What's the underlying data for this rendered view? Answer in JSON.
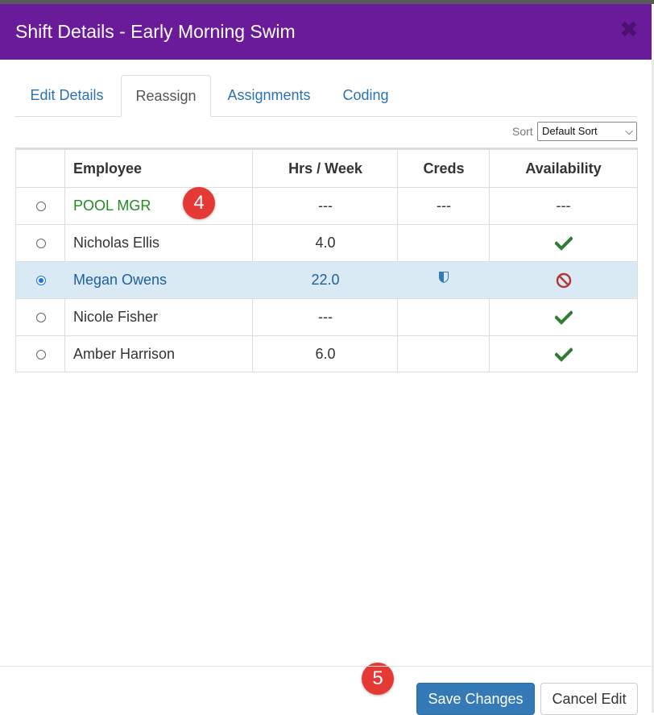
{
  "modal": {
    "title": "Shift Details - Early Morning Swim",
    "close_glyph": "✖"
  },
  "tabs": [
    {
      "label": "Edit Details",
      "active": false
    },
    {
      "label": "Reassign",
      "active": true
    },
    {
      "label": "Assignments",
      "active": false
    },
    {
      "label": "Coding",
      "active": false
    }
  ],
  "sort": {
    "label": "Sort",
    "selected": "Default Sort"
  },
  "table": {
    "headers": [
      "",
      "Employee",
      "Hrs / Week",
      "Creds",
      "Availability"
    ],
    "rows": [
      {
        "employee": "POOL MGR",
        "hours": "---",
        "creds": "---",
        "availability": "---",
        "selected": false
      },
      {
        "employee": "Nicholas Ellis",
        "hours": "4.0",
        "creds": "",
        "availability": "check-icon",
        "selected": false
      },
      {
        "employee": "Megan Owens",
        "hours": "22.0",
        "creds": "shield-icon",
        "availability": "unavailable-icon",
        "selected": true
      },
      {
        "employee": "Nicole Fisher",
        "hours": "---",
        "creds": "",
        "availability": "check-icon",
        "selected": false
      },
      {
        "employee": "Amber Harrison",
        "hours": "6.0",
        "creds": "",
        "availability": "check-icon",
        "selected": false
      }
    ]
  },
  "callouts": [
    "4",
    "5"
  ],
  "footer": {
    "save_label": "Save Changes",
    "cancel_label": "Cancel Edit"
  },
  "colors": {
    "header": "#6a1b9a",
    "primary_button": "#337ab7",
    "selected_row": "#d9eaf4",
    "check": "#2e7d32",
    "unavailable": "#b03a3a",
    "callout": "#e53935"
  }
}
